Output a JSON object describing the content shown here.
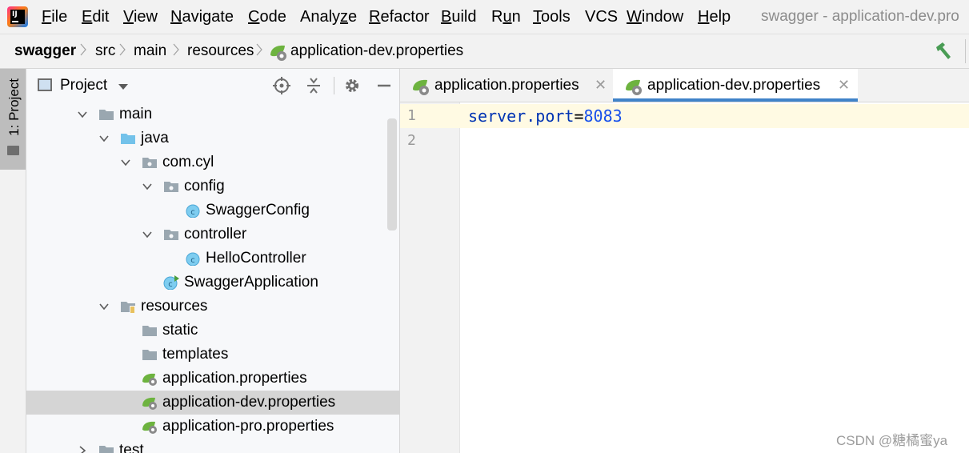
{
  "menubar": {
    "items": [
      {
        "label": "File",
        "u": "F",
        "rest": "ile"
      },
      {
        "label": "Edit",
        "u": "E",
        "rest": "dit"
      },
      {
        "label": "View",
        "u": "V",
        "rest": "iew"
      },
      {
        "label": "Navigate",
        "u": "N",
        "rest": "avigate"
      },
      {
        "label": "Code",
        "u": "C",
        "rest": "ode"
      },
      {
        "label": "Analyze",
        "u": "",
        "pre": "Analy",
        "uu": "z",
        "post": "e"
      },
      {
        "label": "Refactor",
        "u": "R",
        "rest": "efactor"
      },
      {
        "label": "Build",
        "u": "B",
        "rest": "uild"
      },
      {
        "label": "Run",
        "pre": "R",
        "uu": "u",
        "post": "n"
      },
      {
        "label": "Tools",
        "u": "T",
        "rest": "ools"
      },
      {
        "label": "VCS",
        "u": "",
        "rest": "VCS"
      },
      {
        "label": "Window",
        "u": "W",
        "rest": "indow"
      },
      {
        "label": "Help",
        "u": "H",
        "rest": "elp"
      }
    ],
    "window_title": "swagger - application-dev.pro"
  },
  "breadcrumb": {
    "items": [
      "swagger",
      "src",
      "main",
      "resources",
      "application-dev.properties"
    ]
  },
  "left_stripe": {
    "tab_label": "1: Project"
  },
  "project_panel": {
    "title": "Project",
    "tree": [
      {
        "label": "main",
        "icon": "folder-icon",
        "expanded": true
      },
      {
        "label": "java",
        "icon": "source-folder-icon",
        "expanded": true
      },
      {
        "label": "com.cyl",
        "icon": "package-icon",
        "expanded": true
      },
      {
        "label": "config",
        "icon": "package-icon",
        "expanded": true
      },
      {
        "label": "SwaggerConfig",
        "icon": "class-icon"
      },
      {
        "label": "controller",
        "icon": "package-icon",
        "expanded": true
      },
      {
        "label": "HelloController",
        "icon": "class-icon"
      },
      {
        "label": "SwaggerApplication",
        "icon": "spring-boot-class-icon"
      },
      {
        "label": "resources",
        "icon": "resources-folder-icon",
        "expanded": true
      },
      {
        "label": "static",
        "icon": "folder-icon"
      },
      {
        "label": "templates",
        "icon": "folder-icon"
      },
      {
        "label": "application.properties",
        "icon": "spring-properties-icon"
      },
      {
        "label": "application-dev.properties",
        "icon": "spring-properties-icon",
        "selected": true
      },
      {
        "label": "application-pro.properties",
        "icon": "spring-properties-icon"
      },
      {
        "label": "test",
        "icon": "folder-icon",
        "expanded": false
      }
    ]
  },
  "editor": {
    "tabs": [
      {
        "label": "application.properties",
        "active": false
      },
      {
        "label": "application-dev.properties",
        "active": true
      }
    ],
    "line_numbers": [
      "1",
      "2"
    ],
    "code": {
      "key": "server.port",
      "op": "=",
      "value": "8083"
    }
  },
  "watermark": "CSDN @糖橘蜜ya",
  "colors": {
    "accent": "#4083c9",
    "selection": "#d5d5d5",
    "caret_line": "#fffae3",
    "spring_green": "#6db33f"
  }
}
